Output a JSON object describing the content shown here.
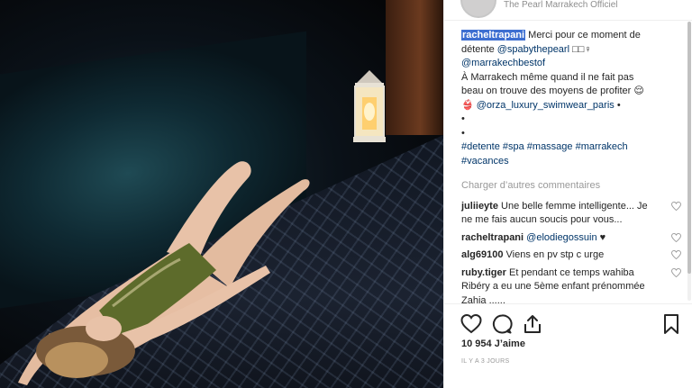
{
  "post": {
    "account_name": "The Pearl Marrakech Officiel",
    "author": "racheltrapani",
    "caption_line1": "Merci pour ce moment de détente ",
    "caption_mention1": "@spabythepearl",
    "caption_emoji1": " □□♀",
    "caption_mention2": "@marrakechbestof",
    "caption_line2": "À Marrakech même quand il ne fait pas beau on trouve des moyens de profiter 😌",
    "caption_line3_prefix": "👙 ",
    "caption_mention3": "@orza_luxury_swimwear_paris",
    "caption_bullet1": " •",
    "caption_bullet2": "•",
    "caption_bullet3": "•",
    "hashtags": "#detente #spa #massage #marrakech #vacances",
    "load_more": "Charger d’autres commentaires",
    "likes": "10 954 J’aime",
    "time_ago": "IL Y A 3 JOURS"
  },
  "comments": [
    {
      "user": "juliieyte",
      "text": " Une belle femme intelligente... Je ne me fais aucun soucis pour vous..."
    },
    {
      "user": "racheltrapani",
      "mention": "@elodiegossuin",
      "text": " ♥"
    },
    {
      "user": "alg69100",
      "text": " Viens en pv stp c urge"
    },
    {
      "user": "ruby.tiger",
      "text": " Et pendant ce temps wahiba Ribéry a eu une 5ème enfant prénommée Zahia ......"
    }
  ],
  "icons": {
    "like": "heart-icon",
    "comment": "comment-icon",
    "share": "share-icon",
    "save": "bookmark-icon"
  }
}
